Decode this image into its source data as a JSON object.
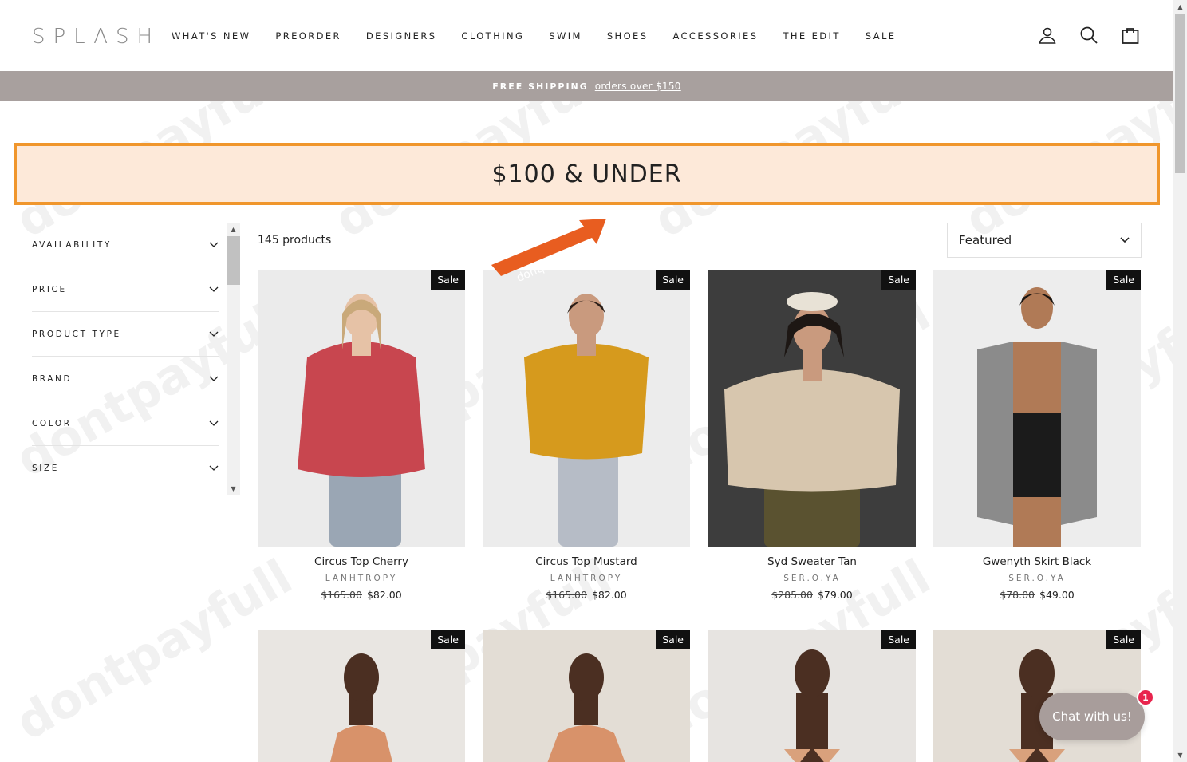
{
  "header": {
    "logo": "SPLASH",
    "nav": [
      "WHAT'S NEW",
      "PREORDER",
      "DESIGNERS",
      "CLOTHING",
      "SWIM",
      "SHOES",
      "ACCESSORIES",
      "THE EDIT",
      "SALE"
    ],
    "icons": [
      "account-icon",
      "search-icon",
      "cart-icon"
    ]
  },
  "announcement": {
    "strong": "FREE SHIPPING",
    "link": "orders over $150"
  },
  "banner": {
    "title": "$100 & UNDER"
  },
  "sidebar": {
    "filters": [
      "AVAILABILITY",
      "PRICE",
      "PRODUCT TYPE",
      "BRAND",
      "COLOR",
      "SIZE"
    ]
  },
  "listing": {
    "count": "145 products",
    "sort": "Featured"
  },
  "promo_tag": "dontpayfull",
  "watermark": "dontpayfull",
  "products": [
    {
      "title": "Circus Top Cherry",
      "vendor": "LANHTROPY",
      "old_price": "$165.00",
      "price": "$82.00",
      "badge": "Sale",
      "top_color": "#c8464f",
      "bottom_color": "#9aa6b4",
      "bg": "#ebebeb",
      "skin": "#e6c2a6",
      "hair": "#c9a97a"
    },
    {
      "title": "Circus Top Mustard",
      "vendor": "LANHTROPY",
      "old_price": "$165.00",
      "price": "$82.00",
      "badge": "Sale",
      "top_color": "#d69a1d",
      "bottom_color": "#b6bcc6",
      "bg": "#ececec",
      "skin": "#c99a7e",
      "hair": "#2a1e18"
    },
    {
      "title": "Syd Sweater Tan",
      "vendor": "SER.O.YA",
      "old_price": "$285.00",
      "price": "$79.00",
      "badge": "Sale",
      "top_color": "#d7c6ae",
      "bottom_color": "#5a5230",
      "bg": "#3d3d3d",
      "skin": "#c99a7e",
      "hair": "#1d1714"
    },
    {
      "title": "Gwenyth Skirt Black",
      "vendor": "SER.O.YA",
      "old_price": "$78.00",
      "price": "$49.00",
      "badge": "Sale",
      "top_color": "#8b8b8b",
      "bottom_color": "#1b1b1b",
      "bg": "#ededed",
      "skin": "#b07a56",
      "hair": "#1b1511"
    },
    {
      "badge": "Sale",
      "top_color": "#d8926a",
      "bg": "#e9e6e2",
      "skin": "#4b2f22"
    },
    {
      "badge": "Sale",
      "top_color": "#d8926a",
      "bg": "#e3ddd5",
      "skin": "#4b2f22"
    },
    {
      "badge": "Sale",
      "top_color": "#d9a17c",
      "bg": "#e7e4e1",
      "skin": "#4b2f22"
    },
    {
      "badge": "Sale",
      "top_color": "#d9a17c",
      "bg": "#e3ddd5",
      "skin": "#4b2f22"
    }
  ],
  "chat": {
    "label": "Chat with us!",
    "badge": "1"
  }
}
